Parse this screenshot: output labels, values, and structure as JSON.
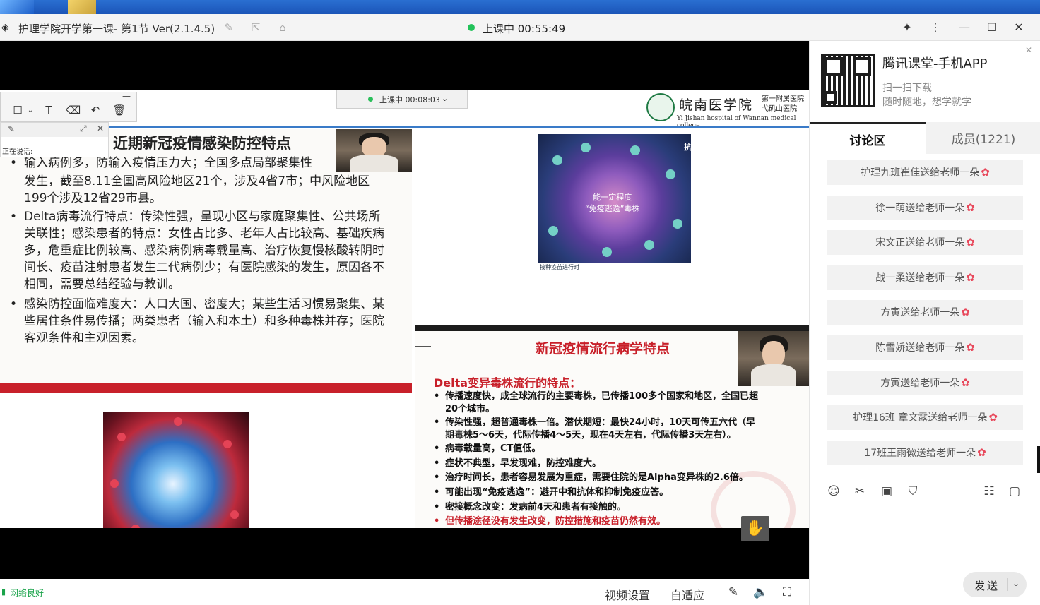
{
  "window": {
    "title": "护理学院开学第一课- 第1节 Ver(2.1.4.5)",
    "live_status": "上课中 00:55:49"
  },
  "shared_screen": {
    "inner_status": "上课中 00:08:03",
    "hospital_name": "皖南医学院",
    "hospital_sub_line1": "第一附属医院",
    "hospital_sub_line2": "弋矶山医院",
    "hospital_en": "Yi Jishan hospital of Wannan medical college",
    "slide1": {
      "title": "近期新冠疫情感染防控特点",
      "p1_line1": "输入病例多，防输入疫情压力大；全国多点局部聚集性",
      "p1_line2": "发生，截至8.11全国高风险地区21个，涉及4省7市；中风险地区",
      "p1_line3": "199个涉及12省29市县。",
      "p2_line1": "Delta病毒流行特点：传染性强，呈现小区与家庭聚集性、公共场所",
      "p2_line2": "关联性；感染患者的特点：女性占比多、老年人占比较高、基础疾病",
      "p2_line3": "多，危重症比例较高、感染病例病毒载量高、治疗恢复慢核酸转阴时",
      "p2_line4": "间长、疫苗注射患者发生二代病例少；有医院感染的发生，原因各不",
      "p2_line5": "相同，需要总结经验与教训。",
      "p3_line1": "感染防控面临难度大：人口大国、密度大；某些生活习惯易聚集、某",
      "p3_line2": "些居住条件易传播；两类患者（输入和本土）和多种毒株并存；医院",
      "p3_line3": "客观条件和主观因素。",
      "bullet": "•"
    },
    "virus1_caption_line1": "能一定程度",
    "virus1_caption_line2": "“免疫逃逸”毒株",
    "virus1_corner": "抗",
    "virus1_footer": "接种疫苗进行时",
    "slide2": {
      "title": "新冠疫情流行病学特点",
      "subtitle": "Delta变异毒株流行的特点：",
      "lines": [
        "传播速度快，成全球流行的主要毒株，已传播100多个国家和地区，全国已超",
        "20个城市。",
        "传染性强，超普通毒株一倍。潜伏期短：最快24小时，10天可传五六代（早",
        "期毒株5～6天，代际传播4～5天，现在4天左右，代际传播3天左右）。",
        "病毒载量高，CT值低。",
        "症状不典型，早发现难，防控难度大。",
        "治疗时间长，患者容易发展为重症，需要住院的是Alpha变异株的2.6倍。",
        "可能出现“免疫逃逸”：避开中和抗体和抑制免疫应答。",
        "密接概念改变：发病前4天和患者有接触的。",
        "但传播途径没有发生改变，防控措施和疫苗仍然有效。"
      ],
      "bullet": "•"
    }
  },
  "overlay": {
    "speaking_label": "正在说话:"
  },
  "statusbar": {
    "network": "网络良好",
    "video_settings": "视频设置",
    "fit": "自适应"
  },
  "panel": {
    "app_title": "腾讯课堂-手机APP",
    "app_sub1": "扫一扫下载",
    "app_sub2": "随时随地，想学就学",
    "tabs": [
      "讨论区",
      "成员(1221)"
    ],
    "messages": [
      "护理九班崔佳送给老师一朵",
      "徐一萌送给老师一朵",
      "宋文正送给老师一朵",
      "战一柔送给老师一朵",
      "方寅送给老师一朵",
      "陈雪娇送给老师一朵",
      "方寅送给老师一朵",
      "护理16班 章文露送给老师一朵",
      "17班王雨徽送给老师一朵"
    ],
    "send_label": "发送"
  },
  "colors": {
    "accent_red": "#c8202a",
    "live_green": "#22c25a",
    "network_green": "#1aa34a",
    "flower": "#e8475a"
  }
}
